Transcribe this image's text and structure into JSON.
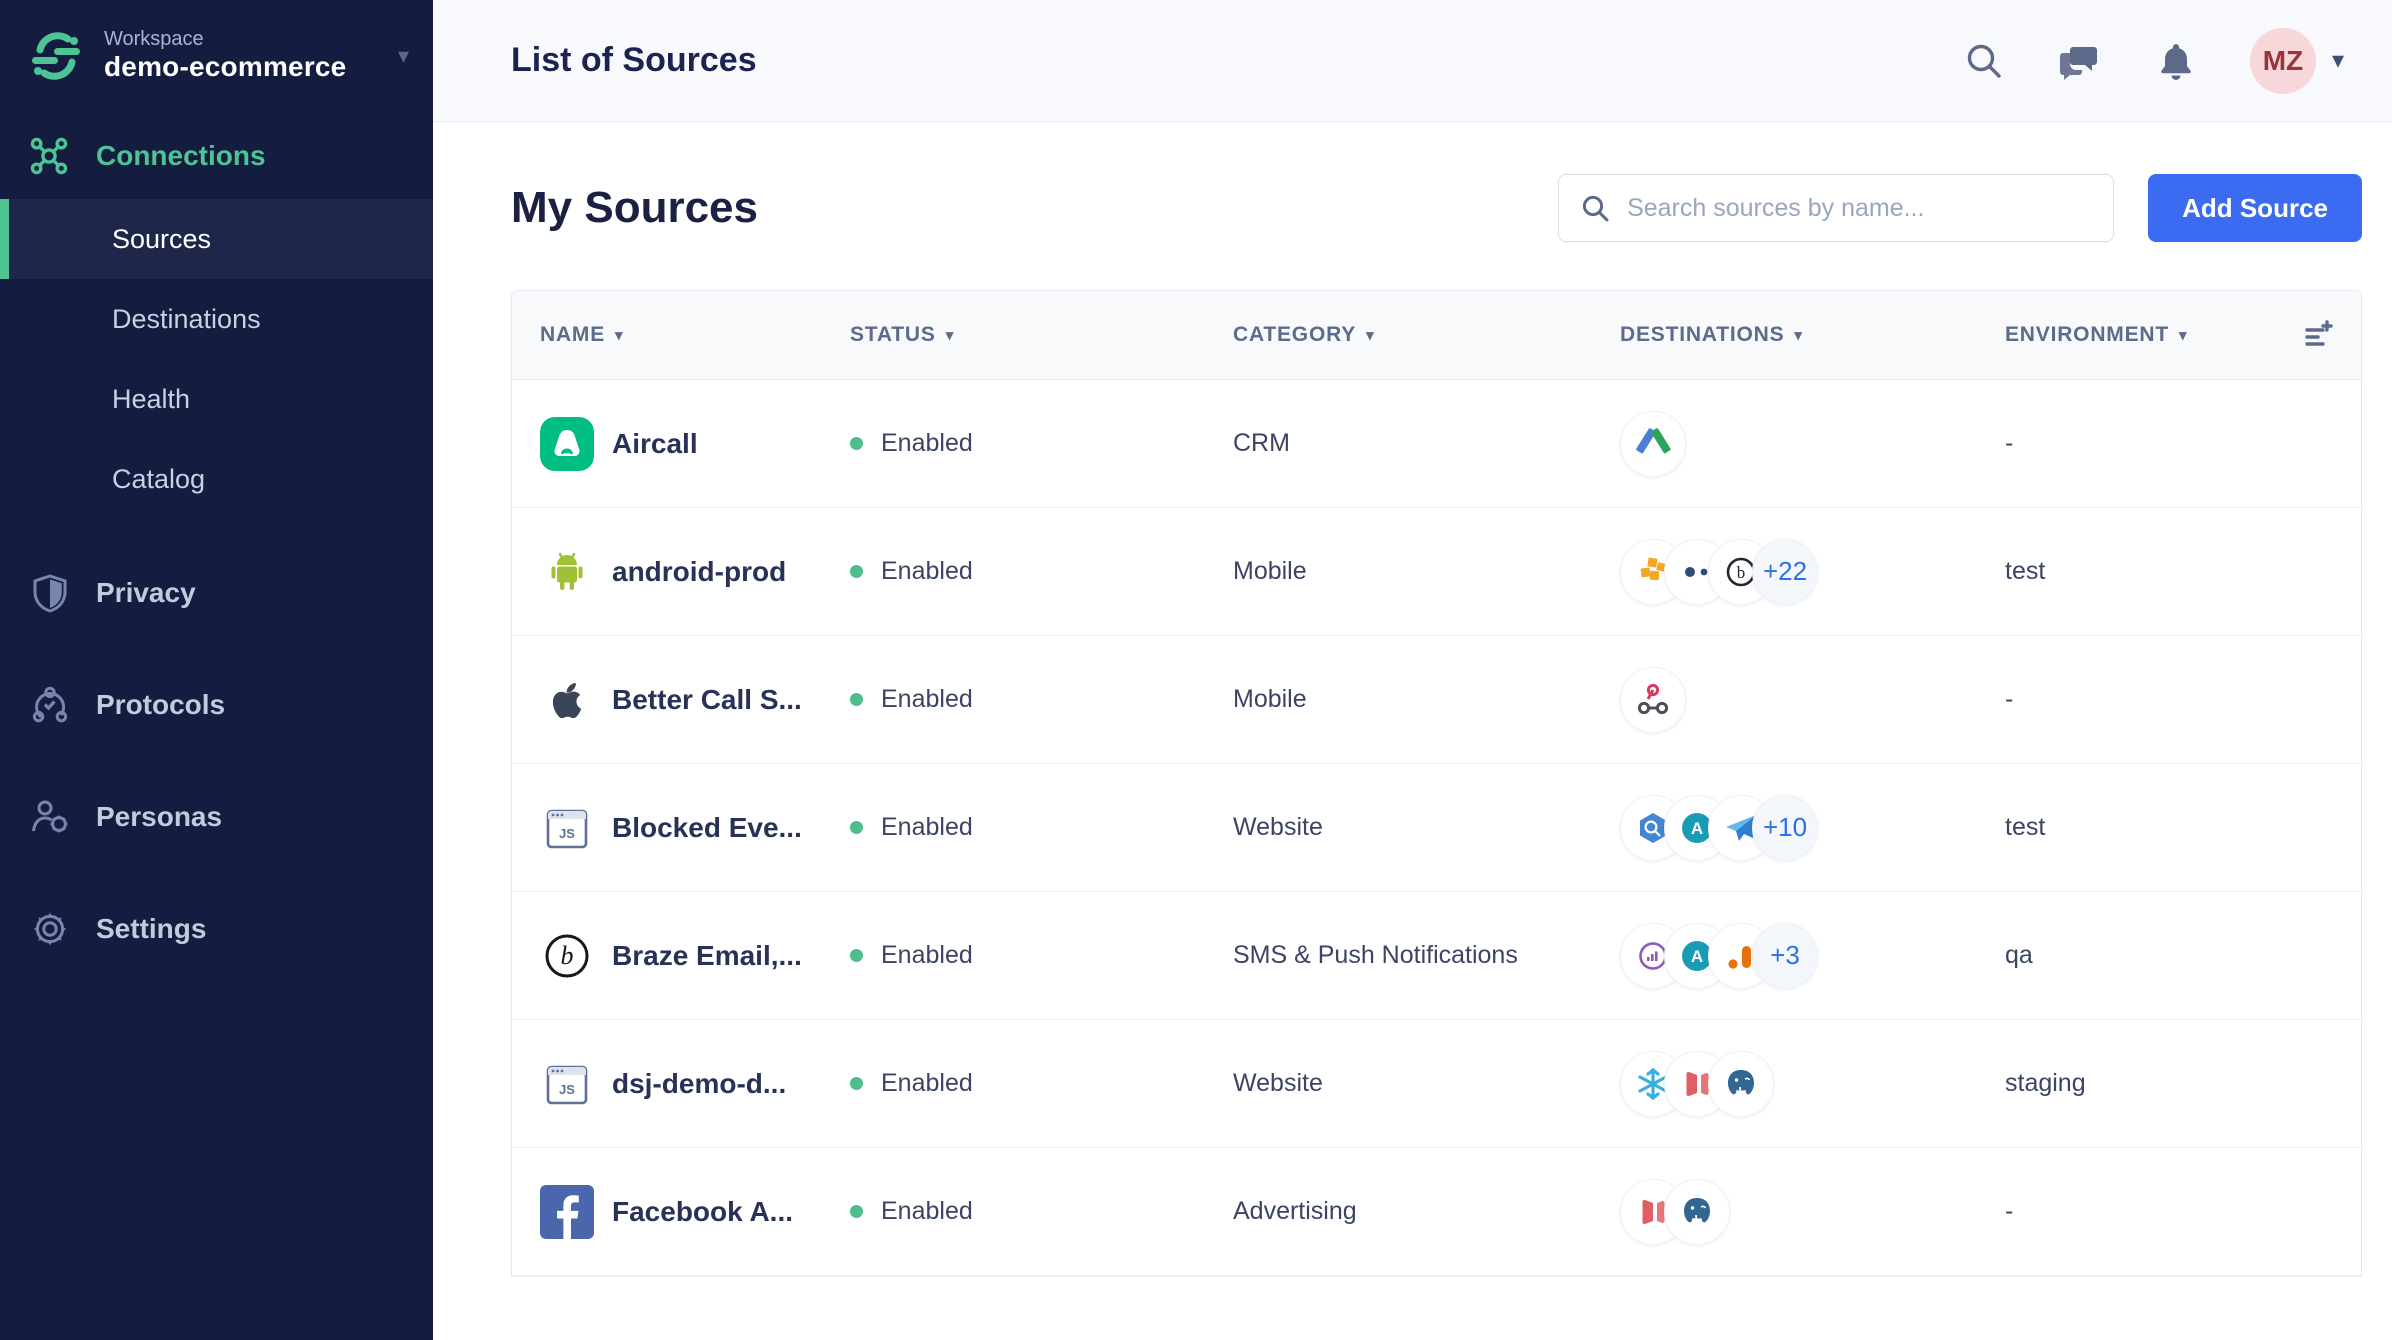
{
  "colors": {
    "sidebar_bg": "#141c40",
    "accent_green": "#4cc495",
    "active_bar_green": "#4ec394",
    "button_blue": "#3b6bf0",
    "badge_blue": "#2d6fe5",
    "status_green": "#4dbe8c",
    "topbar_bg": "#f8f9fc",
    "avatar_bg": "#f7d7da",
    "avatar_text": "#96363b"
  },
  "sidebar": {
    "workspace_label": "Workspace",
    "workspace_name": "demo-ecommerce",
    "connections": {
      "label": "Connections",
      "items": [
        {
          "label": "Sources",
          "active": true
        },
        {
          "label": "Destinations",
          "active": false
        },
        {
          "label": "Health",
          "active": false
        },
        {
          "label": "Catalog",
          "active": false
        }
      ]
    },
    "sections": [
      {
        "label": "Privacy",
        "icon": "shield-icon"
      },
      {
        "label": "Protocols",
        "icon": "protocols-icon"
      },
      {
        "label": "Personas",
        "icon": "personas-icon"
      },
      {
        "label": "Settings",
        "icon": "gear-icon"
      }
    ]
  },
  "topbar": {
    "title": "List of Sources",
    "avatar_initials": "MZ"
  },
  "main": {
    "heading": "My Sources",
    "search_placeholder": "Search sources by name...",
    "add_button_label": "Add Source"
  },
  "table": {
    "columns": [
      {
        "label": "NAME",
        "sortable": true
      },
      {
        "label": "STATUS",
        "sortable": true
      },
      {
        "label": "CATEGORY",
        "sortable": true
      },
      {
        "label": "DESTINATIONS",
        "sortable": true
      },
      {
        "label": "ENVIRONMENT",
        "sortable": true
      }
    ],
    "rows": [
      {
        "name": "Aircall",
        "source_icon": "aircall",
        "status": "Enabled",
        "category": "CRM",
        "destinations": [
          "google-adwords"
        ],
        "more": null,
        "environment": "-"
      },
      {
        "name": "android-prod",
        "source_icon": "android",
        "status": "Enabled",
        "category": "Mobile",
        "destinations": [
          "aws",
          "two-dots-logo",
          "circle-letter"
        ],
        "more": "+22",
        "environment": "test"
      },
      {
        "name": "Better Call S...",
        "source_icon": "apple",
        "status": "Enabled",
        "category": "Mobile",
        "destinations": [
          "webhook"
        ],
        "more": null,
        "environment": "-"
      },
      {
        "name": "Blocked Eve...",
        "source_icon": "javascript",
        "status": "Enabled",
        "category": "Website",
        "destinations": [
          "bigquery",
          "amplitude",
          "paper-plane"
        ],
        "more": "+10",
        "environment": "test"
      },
      {
        "name": "Braze Email,...",
        "source_icon": "braze",
        "status": "Enabled",
        "category": "SMS & Push Notifications",
        "destinations": [
          "gauge-ring",
          "amplitude",
          "google-analytics"
        ],
        "more": "+3",
        "environment": "qa"
      },
      {
        "name": "dsj-demo-d...",
        "source_icon": "javascript",
        "status": "Enabled",
        "category": "Website",
        "destinations": [
          "snowflake",
          "redshift",
          "postgres"
        ],
        "more": null,
        "environment": "staging"
      },
      {
        "name": "Facebook A...",
        "source_icon": "facebook",
        "status": "Enabled",
        "category": "Advertising",
        "destinations": [
          "redshift",
          "postgres"
        ],
        "more": null,
        "environment": "-"
      }
    ]
  }
}
